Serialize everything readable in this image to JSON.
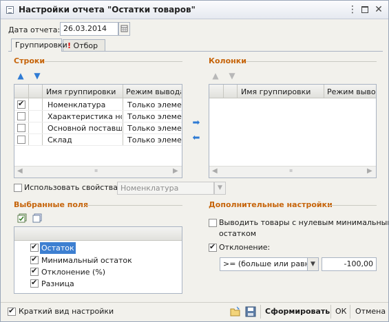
{
  "window": {
    "title": "Настройки отчета  \"Остатки товаров\""
  },
  "date": {
    "label": "Дата отчета:",
    "value": "26.03.2014"
  },
  "tabs": [
    {
      "label": "Группировки"
    },
    {
      "label": "Отбор"
    }
  ],
  "rows_section": {
    "title": "Строки",
    "columns": [
      "Имя группировки",
      "Режим вывода"
    ],
    "items": [
      {
        "name": "Номенклатура",
        "mode": "Только элеме...",
        "checked": true
      },
      {
        "name": "Характеристика но...",
        "mode": "Только элеме...",
        "checked": false
      },
      {
        "name": "Основной поставщ...",
        "mode": "Только элеме...",
        "checked": false
      },
      {
        "name": "Склад",
        "mode": "Только элеме...",
        "checked": false
      }
    ]
  },
  "columns_section": {
    "title": "Колонки",
    "columns": [
      "Имя группировки",
      "Режим выво..."
    ]
  },
  "use_props": {
    "label": "Использовать свойства",
    "value": "Номенклатура",
    "checked": false
  },
  "selected_fields": {
    "title": "Выбранные поля",
    "items": [
      {
        "label": "Остаток",
        "checked": true
      },
      {
        "label": "Минимальный остаток",
        "checked": true
      },
      {
        "label": "Отклонение (%)",
        "checked": true
      },
      {
        "label": "Разница",
        "checked": true
      }
    ]
  },
  "extra": {
    "title": "Дополнительные настройки",
    "zero_min_line1": "Выводить товары с нулевым минимальным",
    "zero_min_line2": "остатком",
    "zero_min_checked": false,
    "deviation_label": "Отклонение:",
    "deviation_checked": true,
    "condition": ">= (больше или равно)",
    "threshold": "-100,00"
  },
  "bottom": {
    "short_view_label": "Краткий вид настройки",
    "short_view_checked": true,
    "generate_label": "Сформировать",
    "ok_label": "ОК",
    "cancel_label": "Отмена"
  },
  "colors": {
    "section_title": "#c6640a",
    "accent_blue": "#2f7bd4"
  }
}
